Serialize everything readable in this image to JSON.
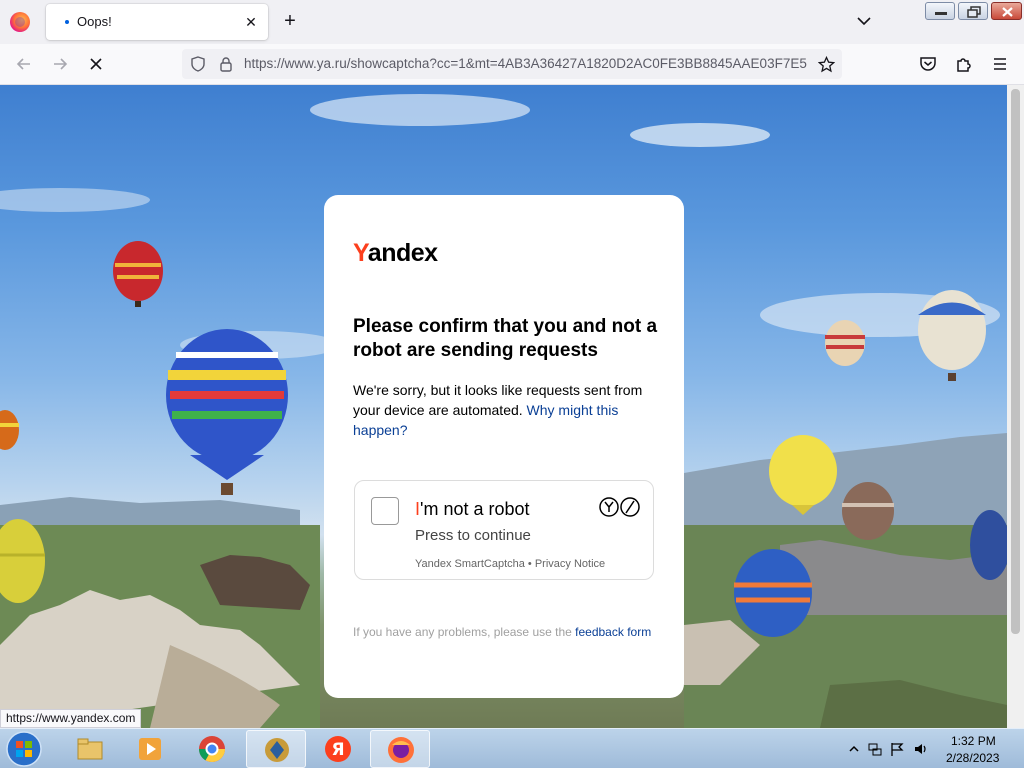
{
  "browser": {
    "tab": {
      "title": "Oops!"
    },
    "url": "https://www.ya.ru/showcaptcha?cc=1&mt=4AB3A36427A1820D2AC0FE3BB8845AAE03F7E5",
    "status_url": "https://www.yandex.com",
    "accent": "#0060df"
  },
  "captcha": {
    "logo_first": "Y",
    "logo_rest": "andex",
    "heading": "Please confirm that you and not a robot are sending requests",
    "description": "We're sorry, but it looks like requests sent from your device are automated.",
    "why_link": "Why might this happen?",
    "checkbox_prefix": "I",
    "checkbox_label": "'m not a robot",
    "press_label": "Press to continue",
    "smartcaptcha": "Yandex SmartCaptcha",
    "separator": "•",
    "privacy": "Privacy Notice",
    "feedback_prefix": "If you have any problems, please use the",
    "feedback_link": "feedback form",
    "accent": "#fc3f1d",
    "link_color": "#0a3f95"
  },
  "taskbar": {
    "apps": [
      "windows-explorer",
      "media-player",
      "chrome",
      "security-tool",
      "yandex-browser",
      "firefox"
    ],
    "time": "1:32 PM",
    "date": "2/28/2023"
  }
}
